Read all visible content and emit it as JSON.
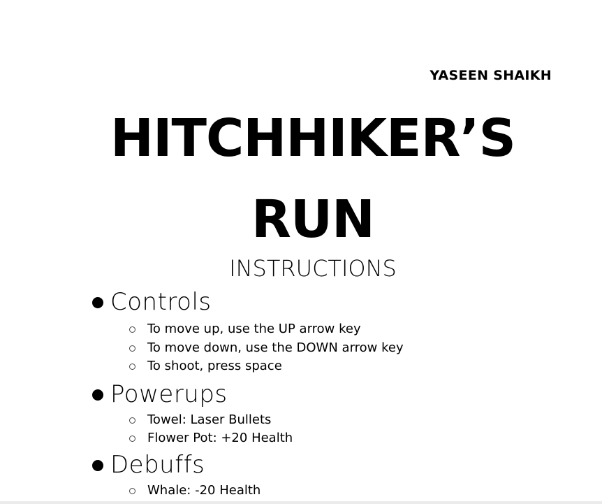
{
  "author": "YASEEN SHAIKH",
  "title": {
    "line1": "HITCHHIKER’S",
    "line2": "RUN"
  },
  "subtitle": "INSTRUCTIONS",
  "sections": [
    {
      "label": "Controls",
      "items": [
        "To move up, use the UP arrow key",
        "To move down, use the DOWN arrow key",
        "To shoot, press space"
      ]
    },
    {
      "label": "Powerups",
      "items": [
        "Towel: Laser Bullets",
        "Flower Pot: +20 Health"
      ]
    },
    {
      "label": "Debuffs",
      "items": [
        "Whale: -20 Health"
      ]
    }
  ]
}
